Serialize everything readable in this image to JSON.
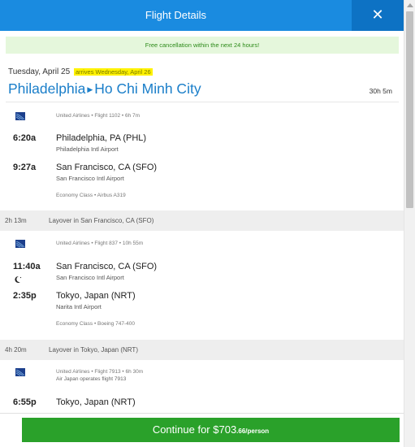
{
  "header": {
    "title": "Flight Details",
    "close_icon": "close-icon"
  },
  "banner": {
    "text": "Free cancellation within the next 24 hours!"
  },
  "trip": {
    "date": "Tuesday, April 25",
    "arrives": "arrives Wednesday, April 26",
    "origin": "Philadelphia",
    "destination": "Ho Chi Minh City",
    "duration": "30h 5m"
  },
  "segments": [
    {
      "airline_info": "United Airlines • Flight 1102 • 6h 7m",
      "dep_time": "6:20a",
      "dep_city": "Philadelphia, PA (PHL)",
      "dep_airport": "Philadelphia Intl Airport",
      "arr_time": "9:27a",
      "arr_city": "San Francisco, CA (SFO)",
      "arr_airport": "San Francisco Intl Airport",
      "cabin": "Economy Class • Airbus A319"
    },
    {
      "airline_info": "United Airlines • Flight 837 • 10h 55m",
      "dep_time": "11:40a",
      "dep_city": "San Francisco, CA (SFO)",
      "dep_airport": "San Francisco Intl Airport",
      "arr_time": "2:35p",
      "arr_city": "Tokyo, Japan (NRT)",
      "arr_airport": "Narita Intl Airport",
      "cabin": "Economy Class • Boeing 747-400"
    },
    {
      "airline_info": "United Airlines • Flight 7913 • 6h 30m",
      "operated": "Air Japan operates flight 7913",
      "dep_time": "6:55p",
      "dep_city": "Tokyo, Japan (NRT)"
    }
  ],
  "layovers": [
    {
      "duration": "2h 13m",
      "text": "Layover in San Francisco, CA (SFO)"
    },
    {
      "duration": "4h 20m",
      "text": "Layover in Tokyo, Japan (NRT)"
    }
  ],
  "footer": {
    "continue_label": "Continue for ",
    "price": "$703",
    "price_cents": ".66/person"
  },
  "colors": {
    "header": "#1a8be0",
    "accent": "#1a7ec9",
    "button": "#2aa12a",
    "banner_bg": "#e5f7dc"
  }
}
